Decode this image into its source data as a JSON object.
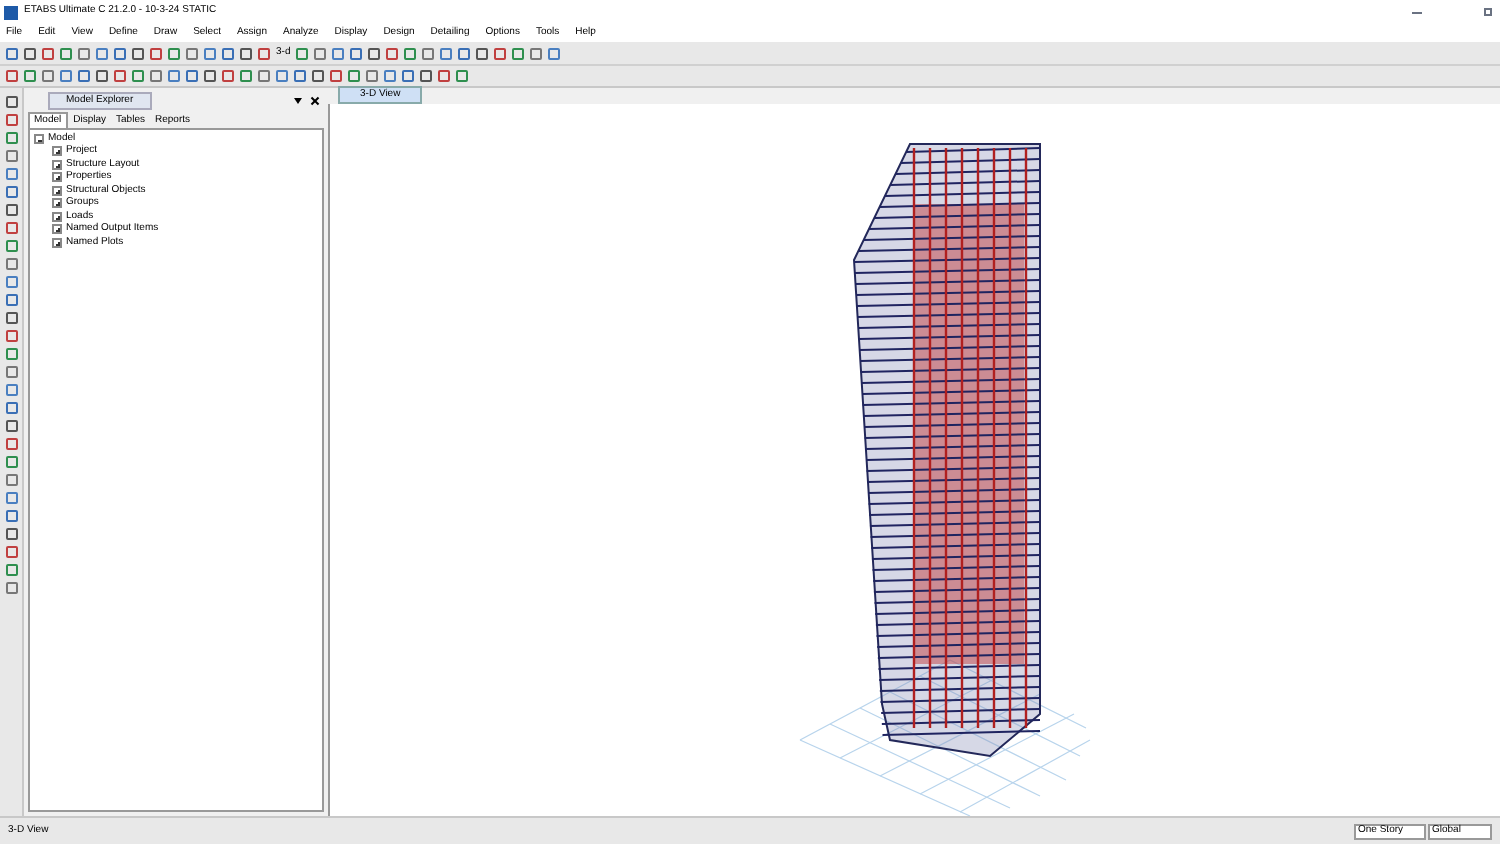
{
  "window": {
    "title": "ETABS Ultimate C 21.2.0 - 10-3-24 STATIC"
  },
  "menu": [
    "File",
    "Edit",
    "View",
    "Define",
    "Draw",
    "Select",
    "Assign",
    "Analyze",
    "Display",
    "Design",
    "Detailing",
    "Options",
    "Tools",
    "Help"
  ],
  "toolbar_labels": [
    "3-d"
  ],
  "model_explorer": {
    "title": "Model Explorer",
    "tabs": [
      {
        "label": "Model",
        "selected": true
      },
      {
        "label": "Display",
        "selected": false
      },
      {
        "label": "Tables",
        "selected": false
      },
      {
        "label": "Reports",
        "selected": false
      }
    ],
    "tree": [
      {
        "label": "Model",
        "expanded": true,
        "children": [
          {
            "label": "Project",
            "expanded": false
          },
          {
            "label": "Structure Layout",
            "expanded": false
          },
          {
            "label": "Properties",
            "expanded": false
          },
          {
            "label": "Structural Objects",
            "expanded": false
          },
          {
            "label": "Groups",
            "expanded": false
          },
          {
            "label": "Loads",
            "expanded": false
          },
          {
            "label": "Named Output Items",
            "expanded": false
          },
          {
            "label": "Named Plots",
            "expanded": false
          }
        ]
      }
    ]
  },
  "view_tabs": [
    {
      "label": "3-D View",
      "selected": true
    }
  ],
  "status_bar": {
    "text": "3-D View",
    "story_dropdown": "One Story",
    "coord_dropdown": "Global"
  }
}
